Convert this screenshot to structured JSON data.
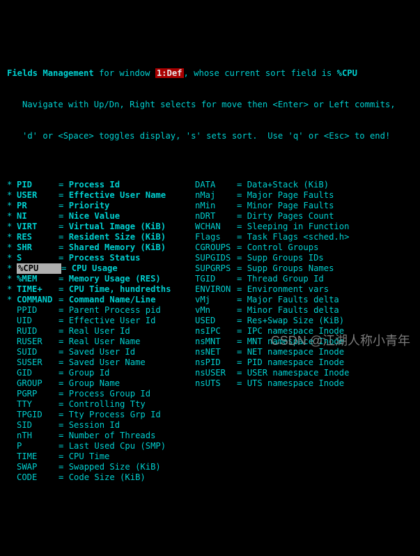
{
  "header": {
    "title": "Fields Management",
    "for_window_prefix": " for window ",
    "window_label": "1:Def",
    "sort_prefix": ", whose current sort field is ",
    "sort_field": "%CPU",
    "line2": "   Navigate with Up/Dn, Right selects for move then <Enter> or Left commits,",
    "line3": "   'd' or <Space> toggles display, 's' sets sort.  Use 'q' or <Esc> to end!"
  },
  "left": [
    {
      "star": "*",
      "bold": true,
      "sel": false,
      "key": "PID",
      "keyw": 60,
      "eq": "= ",
      "desc": "Process Id"
    },
    {
      "star": "*",
      "bold": true,
      "sel": false,
      "key": "USER",
      "keyw": 60,
      "eq": "= ",
      "desc": "Effective User Name"
    },
    {
      "star": "*",
      "bold": true,
      "sel": false,
      "key": "PR",
      "keyw": 60,
      "eq": "= ",
      "desc": "Priority"
    },
    {
      "star": "*",
      "bold": true,
      "sel": false,
      "key": "NI",
      "keyw": 60,
      "eq": "= ",
      "desc": "Nice Value"
    },
    {
      "star": "*",
      "bold": true,
      "sel": false,
      "key": "VIRT",
      "keyw": 60,
      "eq": "= ",
      "desc": "Virtual Image (KiB)"
    },
    {
      "star": "*",
      "bold": true,
      "sel": false,
      "key": "RES",
      "keyw": 60,
      "eq": "= ",
      "desc": "Resident Size (KiB)"
    },
    {
      "star": "*",
      "bold": true,
      "sel": false,
      "key": "SHR",
      "keyw": 60,
      "eq": "= ",
      "desc": "Shared Memory (KiB)"
    },
    {
      "star": "*",
      "bold": true,
      "sel": false,
      "key": "S",
      "keyw": 60,
      "eq": "= ",
      "desc": "Process Status"
    },
    {
      "star": "*",
      "bold": true,
      "sel": true,
      "key": "%CPU",
      "keyw": 60,
      "eq": "= ",
      "desc": "CPU Usage"
    },
    {
      "star": "*",
      "bold": true,
      "sel": false,
      "key": "%MEM",
      "keyw": 60,
      "eq": "= ",
      "desc": "Memory Usage (RES)"
    },
    {
      "star": "*",
      "bold": true,
      "sel": false,
      "key": "TIME+",
      "keyw": 60,
      "eq": "= ",
      "desc": "CPU Time, hundredths"
    },
    {
      "star": "*",
      "bold": true,
      "sel": false,
      "key": "COMMAND",
      "keyw": 60,
      "eq": "= ",
      "desc": "Command Name/Line"
    },
    {
      "star": " ",
      "bold": false,
      "sel": false,
      "key": "PPID",
      "keyw": 60,
      "eq": "= ",
      "desc": "Parent Process pid"
    },
    {
      "star": " ",
      "bold": false,
      "sel": false,
      "key": "UID",
      "keyw": 60,
      "eq": "= ",
      "desc": "Effective User Id"
    },
    {
      "star": " ",
      "bold": false,
      "sel": false,
      "key": "RUID",
      "keyw": 60,
      "eq": "= ",
      "desc": "Real User Id"
    },
    {
      "star": " ",
      "bold": false,
      "sel": false,
      "key": "RUSER",
      "keyw": 60,
      "eq": "= ",
      "desc": "Real User Name"
    },
    {
      "star": " ",
      "bold": false,
      "sel": false,
      "key": "SUID",
      "keyw": 60,
      "eq": "= ",
      "desc": "Saved User Id"
    },
    {
      "star": " ",
      "bold": false,
      "sel": false,
      "key": "SUSER",
      "keyw": 60,
      "eq": "= ",
      "desc": "Saved User Name"
    },
    {
      "star": " ",
      "bold": false,
      "sel": false,
      "key": "GID",
      "keyw": 60,
      "eq": "= ",
      "desc": "Group Id"
    },
    {
      "star": " ",
      "bold": false,
      "sel": false,
      "key": "GROUP",
      "keyw": 60,
      "eq": "= ",
      "desc": "Group Name"
    },
    {
      "star": " ",
      "bold": false,
      "sel": false,
      "key": "PGRP",
      "keyw": 60,
      "eq": "= ",
      "desc": "Process Group Id"
    },
    {
      "star": " ",
      "bold": false,
      "sel": false,
      "key": "TTY",
      "keyw": 60,
      "eq": "= ",
      "desc": "Controlling Tty"
    },
    {
      "star": " ",
      "bold": false,
      "sel": false,
      "key": "TPGID",
      "keyw": 60,
      "eq": "= ",
      "desc": "Tty Process Grp Id"
    },
    {
      "star": " ",
      "bold": false,
      "sel": false,
      "key": "SID",
      "keyw": 60,
      "eq": "= ",
      "desc": "Session Id"
    },
    {
      "star": " ",
      "bold": false,
      "sel": false,
      "key": "nTH",
      "keyw": 60,
      "eq": "= ",
      "desc": "Number of Threads"
    },
    {
      "star": " ",
      "bold": false,
      "sel": false,
      "key": "P",
      "keyw": 60,
      "eq": "= ",
      "desc": "Last Used Cpu (SMP)"
    },
    {
      "star": " ",
      "bold": false,
      "sel": false,
      "key": "TIME",
      "keyw": 60,
      "eq": "= ",
      "desc": "CPU Time"
    },
    {
      "star": " ",
      "bold": false,
      "sel": false,
      "key": "SWAP",
      "keyw": 60,
      "eq": "= ",
      "desc": "Swapped Size (KiB)"
    },
    {
      "star": " ",
      "bold": false,
      "sel": false,
      "key": "CODE",
      "keyw": 60,
      "eq": "= ",
      "desc": "Code Size (KiB)"
    }
  ],
  "right": [
    {
      "key": "DATA",
      "eq": "= ",
      "desc": "Data+Stack (KiB)"
    },
    {
      "key": "nMaj",
      "eq": "= ",
      "desc": "Major Page Faults"
    },
    {
      "key": "nMin",
      "eq": "= ",
      "desc": "Minor Page Faults"
    },
    {
      "key": "nDRT",
      "eq": "= ",
      "desc": "Dirty Pages Count"
    },
    {
      "key": "WCHAN",
      "eq": "= ",
      "desc": "Sleeping in Function"
    },
    {
      "key": "Flags",
      "eq": "= ",
      "desc": "Task Flags <sched.h>"
    },
    {
      "key": "CGROUPS",
      "eq": "= ",
      "desc": "Control Groups"
    },
    {
      "key": "SUPGIDS",
      "eq": "= ",
      "desc": "Supp Groups IDs"
    },
    {
      "key": "SUPGRPS",
      "eq": "= ",
      "desc": "Supp Groups Names"
    },
    {
      "key": "TGID",
      "eq": "= ",
      "desc": "Thread Group Id"
    },
    {
      "key": "ENVIRON",
      "eq": "= ",
      "desc": "Environment vars"
    },
    {
      "key": "vMj",
      "eq": "= ",
      "desc": "Major Faults delta"
    },
    {
      "key": "vMn",
      "eq": "= ",
      "desc": "Minor Faults delta"
    },
    {
      "key": "USED",
      "eq": "= ",
      "desc": "Res+Swap Size (KiB)"
    },
    {
      "key": "nsIPC",
      "eq": "= ",
      "desc": "IPC namespace Inode"
    },
    {
      "key": "nsMNT",
      "eq": "= ",
      "desc": "MNT namespace Inode"
    },
    {
      "key": "nsNET",
      "eq": "= ",
      "desc": "NET namespace Inode"
    },
    {
      "key": "nsPID",
      "eq": "= ",
      "desc": "PID namespace Inode"
    },
    {
      "key": "nsUSER",
      "eq": "= ",
      "desc": "USER namespace Inode"
    },
    {
      "key": "nsUTS",
      "eq": "= ",
      "desc": "UTS namespace Inode"
    }
  ],
  "watermark": "CSDN @江湖人称小青年"
}
